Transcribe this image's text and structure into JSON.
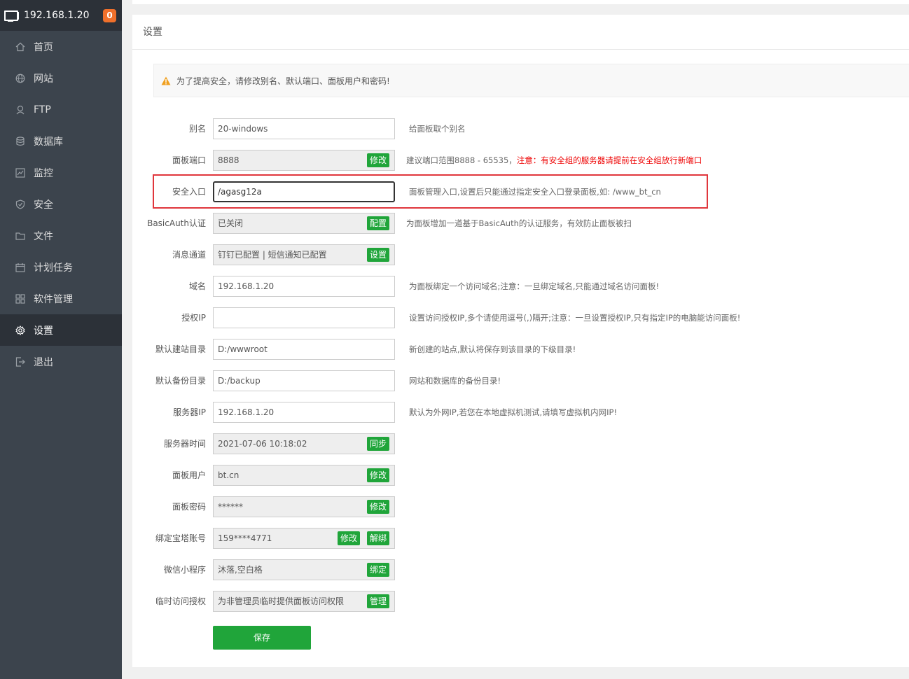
{
  "sidebar": {
    "server_ip": "192.168.1.20",
    "badge_count": "0",
    "items": [
      {
        "label": "首页",
        "icon": "home-icon"
      },
      {
        "label": "网站",
        "icon": "globe-icon"
      },
      {
        "label": "FTP",
        "icon": "ftp-icon"
      },
      {
        "label": "数据库",
        "icon": "database-icon"
      },
      {
        "label": "监控",
        "icon": "monitor-icon"
      },
      {
        "label": "安全",
        "icon": "shield-icon"
      },
      {
        "label": "文件",
        "icon": "folder-icon"
      },
      {
        "label": "计划任务",
        "icon": "calendar-icon"
      },
      {
        "label": "软件管理",
        "icon": "apps-icon"
      },
      {
        "label": "设置",
        "icon": "gear-icon",
        "active": true
      },
      {
        "label": "退出",
        "icon": "logout-icon"
      }
    ]
  },
  "main": {
    "title": "设置",
    "alert": "为了提高安全，请修改别名、默认端口、面板用户和密码!",
    "fields": {
      "alias": {
        "label": "别名",
        "value": "20-windows",
        "help": "给面板取个别名"
      },
      "port": {
        "label": "面板端口",
        "value": "8888",
        "button": "修改",
        "help": "建议端口范围8888 - 65535，",
        "warning": "注意：有安全组的服务器请提前在安全组放行新端口"
      },
      "entry": {
        "label": "安全入口",
        "value": "/agasg12a",
        "help": "面板管理入口,设置后只能通过指定安全入口登录面板,如: /www_bt_cn"
      },
      "basicauth": {
        "label": "BasicAuth认证",
        "value": "已关闭",
        "button": "配置",
        "help": "为面板增加一道基于BasicAuth的认证服务，有效防止面板被扫"
      },
      "message": {
        "label": "消息通道",
        "value": "钉钉已配置 | 短信通知已配置",
        "button": "设置"
      },
      "domain": {
        "label": "域名",
        "value": "192.168.1.20",
        "help": "为面板绑定一个访问域名;注意：一旦绑定域名,只能通过域名访问面板!"
      },
      "auth_ip": {
        "label": "授权IP",
        "value": "",
        "help": "设置访问授权IP,多个请使用逗号(,)隔开;注意：一旦设置授权IP,只有指定IP的电脑能访问面板!"
      },
      "site_dir": {
        "label": "默认建站目录",
        "value": "D:/wwwroot",
        "help": "新创建的站点,默认将保存到该目录的下级目录!"
      },
      "backup_dir": {
        "label": "默认备份目录",
        "value": "D:/backup",
        "help": "网站和数据库的备份目录!"
      },
      "server_ip": {
        "label": "服务器IP",
        "value": "192.168.1.20",
        "help": "默认为外网IP,若您在本地虚拟机测试,请填写虚拟机内网IP!"
      },
      "server_time": {
        "label": "服务器时间",
        "value": "2021-07-06 10:18:02",
        "button": "同步"
      },
      "panel_user": {
        "label": "面板用户",
        "value": "bt.cn",
        "button": "修改"
      },
      "panel_pass": {
        "label": "面板密码",
        "value": "******",
        "button": "修改"
      },
      "bt_account": {
        "label": "绑定宝塔账号",
        "value": "159****4771",
        "button": "修改",
        "button2": "解绑"
      },
      "wechat": {
        "label": "微信小程序",
        "value": "沐落,空白格",
        "button": "绑定"
      },
      "temp_auth": {
        "label": "临时访问授权",
        "value": "为非管理员临时提供面板访问权限",
        "button": "管理"
      }
    },
    "save_label": "保存"
  },
  "colors": {
    "accent": "#20a53a",
    "warning": "#e00000",
    "highlight": "#e0363c",
    "sidebar": "#3c444d"
  }
}
